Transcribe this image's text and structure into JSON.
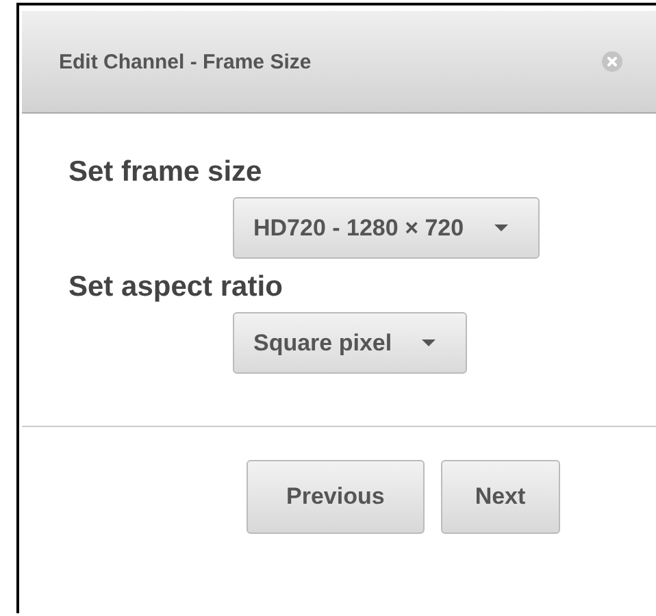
{
  "dialog": {
    "title": "Edit Channel - Frame Size"
  },
  "fields": [
    {
      "label": "Set frame size",
      "value": "HD720 - 1280 × 720"
    },
    {
      "label": "Set aspect ratio",
      "value": "Square pixel"
    }
  ],
  "buttons": [
    "Previous",
    "Next"
  ]
}
